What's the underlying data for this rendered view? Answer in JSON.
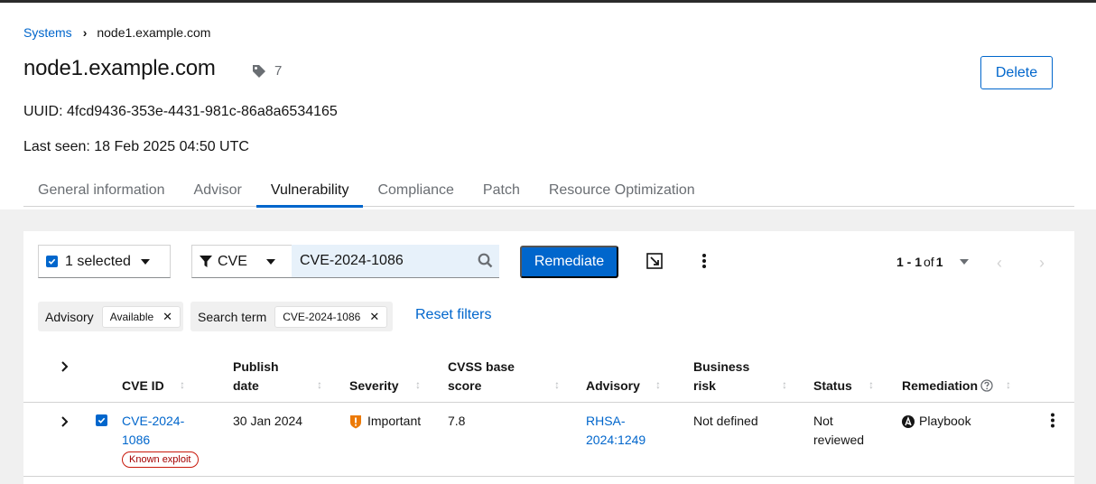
{
  "breadcrumb": {
    "systems": "Systems",
    "separator": "›",
    "current": "node1.example.com"
  },
  "header": {
    "title": "node1.example.com",
    "tag_count": "7",
    "delete_label": "Delete",
    "uuid": "UUID: 4fcd9436-353e-4431-981c-86a8a6534165",
    "last_seen": "Last seen: 18 Feb 2025 04:50 UTC"
  },
  "tabs": [
    {
      "label": "General information"
    },
    {
      "label": "Advisor"
    },
    {
      "label": "Vulnerability",
      "active": true
    },
    {
      "label": "Compliance"
    },
    {
      "label": "Patch"
    },
    {
      "label": "Resource Optimization"
    }
  ],
  "toolbar": {
    "bulk_select_label": "1 selected",
    "filter_type": "CVE",
    "search_value": "CVE-2024-1086",
    "remediate_label": "Remediate",
    "pagination_range": "1 - 1",
    "pagination_of": "of",
    "pagination_total": "1"
  },
  "filters": {
    "groups": [
      {
        "category": "Advisory",
        "chip": "Available"
      },
      {
        "category": "Search term",
        "chip": "CVE-2024-1086"
      }
    ],
    "chip_close": "✕",
    "reset_label": "Reset filters"
  },
  "table": {
    "headers": {
      "cve_id": "CVE ID",
      "publish_date_1": "Publish",
      "publish_date_2": "date",
      "severity": "Severity",
      "cvss_1": "CVSS base",
      "cvss_2": "score",
      "advisory": "Advisory",
      "business_risk_1": "Business",
      "business_risk_2": "risk",
      "status": "Status",
      "remediation": "Remediation"
    },
    "rows": [
      {
        "cve_id_1": "CVE-2024-",
        "cve_id_2": "1086",
        "exploit_badge": "Known exploit",
        "publish_date": "30 Jan 2024",
        "severity": "Important",
        "cvss": "7.8",
        "advisory_1": "RHSA-",
        "advisory_2": "2024:1249",
        "business_risk": "Not defined",
        "status_1": "Not",
        "status_2": "reviewed",
        "remediation": "Playbook"
      }
    ]
  },
  "colors": {
    "accent": "#0066cc",
    "severity_important": "#ec7a08",
    "exploit": "#c9190b"
  }
}
